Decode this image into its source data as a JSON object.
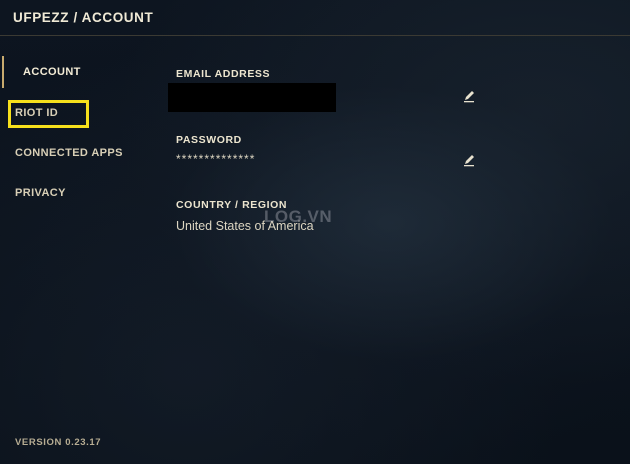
{
  "header": {
    "title": "UFPEZZ / ACCOUNT"
  },
  "sidebar": {
    "items": [
      {
        "label": "ACCOUNT"
      },
      {
        "label": "RIOT ID"
      },
      {
        "label": "CONNECTED APPS"
      },
      {
        "label": "PRIVACY"
      }
    ],
    "active": "ACCOUNT",
    "accent_color": "#c8aa6e",
    "highlight_color": "#f6e01c"
  },
  "fields": {
    "email": {
      "label": "EMAIL ADDRESS",
      "value": ""
    },
    "password": {
      "label": "PASSWORD",
      "value": "**************"
    },
    "country": {
      "label": "COUNTRY / REGION",
      "value": "United States of America"
    }
  },
  "watermark": {
    "text": "LOG.VN"
  },
  "footer": {
    "version": "VERSION 0.23.17"
  }
}
